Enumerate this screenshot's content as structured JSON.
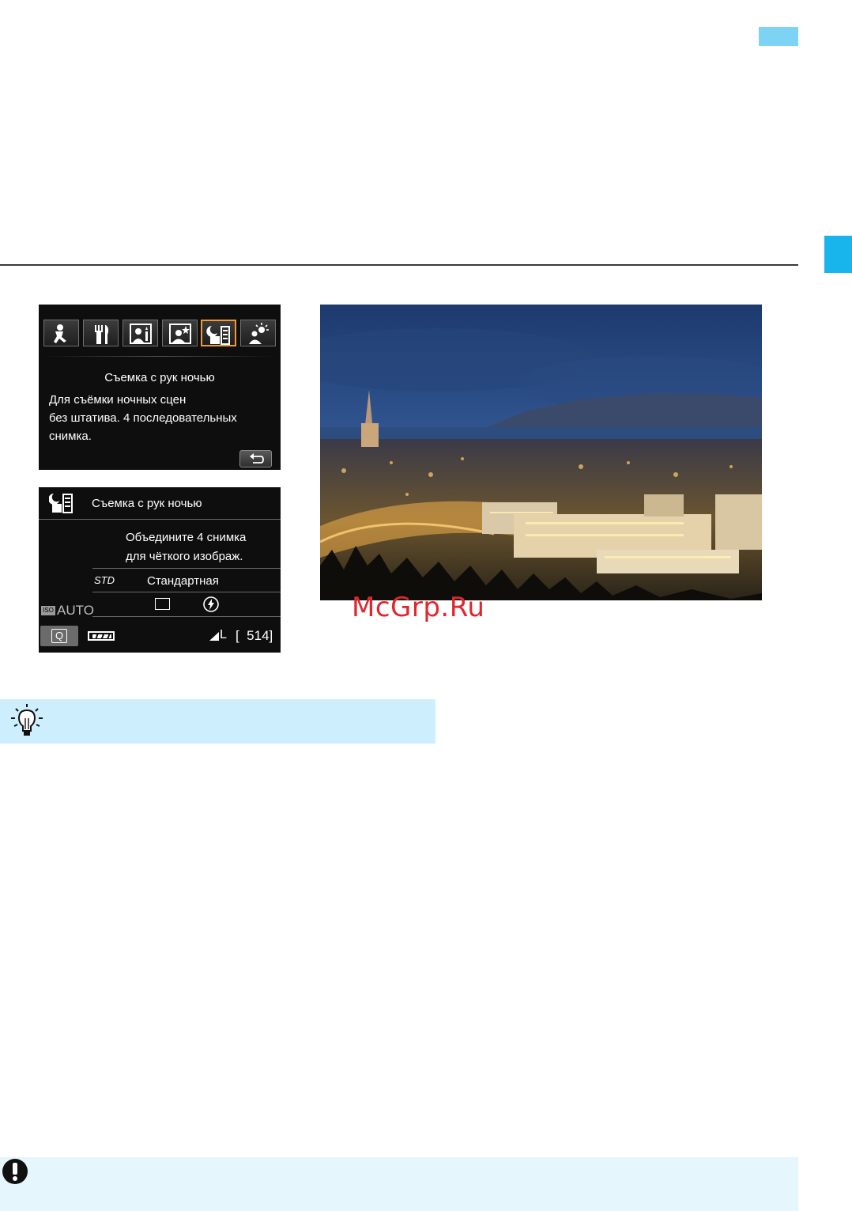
{
  "screen1": {
    "title": "Съемка с рук ночью",
    "desc_line1": "Для съёмки ночных сцен",
    "desc_line2": "без штатива. 4 последовательных",
    "desc_line3": "снимка."
  },
  "screen2": {
    "title": "Съемка с рук ночью",
    "line1": "Объедините 4 снимка",
    "line2": "для чёткого изображ.",
    "picture_style_tag": "STD",
    "picture_style": "Стандартная",
    "iso_label": "AUTO",
    "q_label": "Q",
    "quality": "L",
    "shots_remaining": "[  514]"
  },
  "watermark": "McGrp.Ru",
  "colors": {
    "accent_blue": "#18b4ec",
    "tip_bg": "#cdeefc",
    "selected_orange": "#f39a2a",
    "watermark_red": "#e0262e"
  },
  "icons": [
    "child-mode-icon",
    "food-mode-icon",
    "candlelight-portrait-icon",
    "night-portrait-icon",
    "handheld-night-icon",
    "hdr-backlight-icon",
    "back-arrow-icon",
    "bulb-tip-icon",
    "caution-icon"
  ]
}
